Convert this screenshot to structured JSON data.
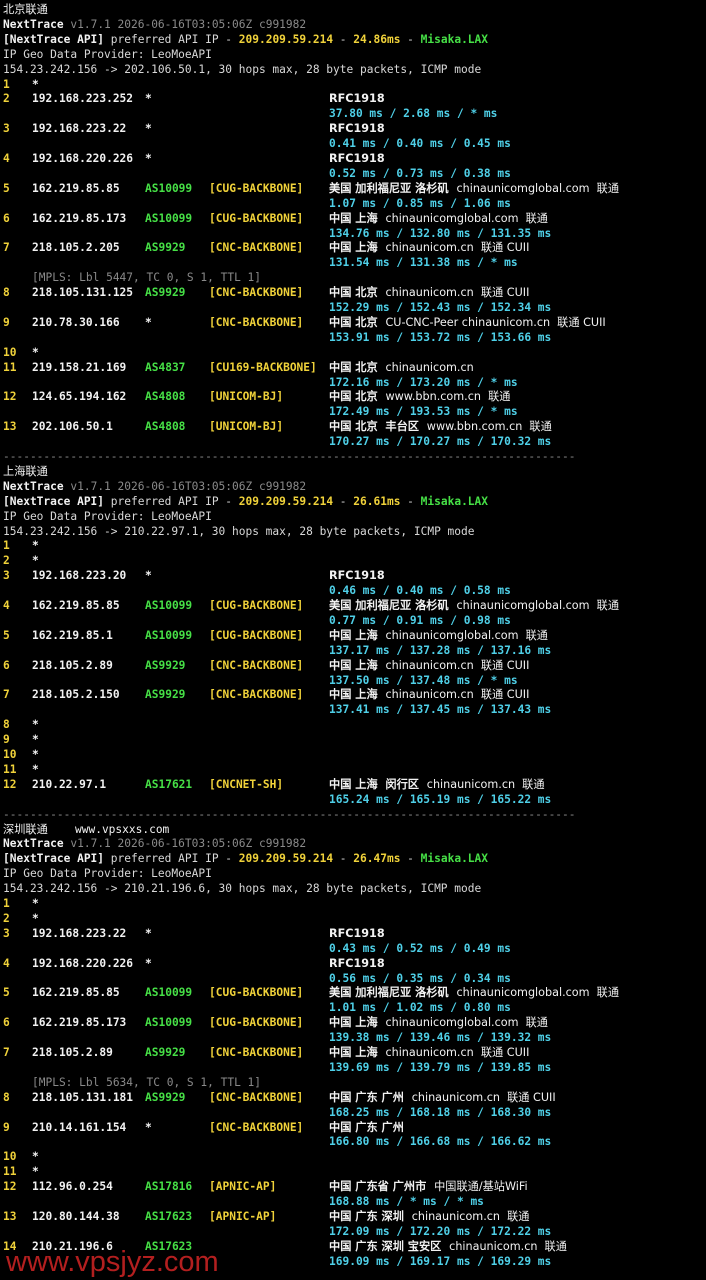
{
  "colors": {
    "background": "#000000",
    "text": "#d8d8d8",
    "hop": "#f0d23a",
    "asn": "#46e046",
    "tag": "#f0d23a",
    "latency": "#4fd0e8",
    "meta": "#8a8a8a",
    "watermark": "#e62828"
  },
  "sections": [
    {
      "heading": "北京联通",
      "heading_extra": "",
      "version": "v1.7.1 2026-06-16T03:05:06Z c991982",
      "api_ip": "209.209.59.214",
      "api_latency": "24.86ms",
      "api_node": "Misaka.LAX",
      "route": "154.23.242.156 -> 202.106.50.1, 30 hops max, 28 byte packets, ICMP mode",
      "hops": [
        {
          "n": "1",
          "ip": "*"
        },
        {
          "n": "2",
          "ip": "192.168.223.252",
          "asn": "*",
          "geo": "RFC1918",
          "rtt": "37.80 ms / 2.68 ms / * ms"
        },
        {
          "n": "3",
          "ip": "192.168.223.22",
          "asn": "*",
          "geo": "RFC1918",
          "rtt": "0.41 ms / 0.40 ms / 0.45 ms"
        },
        {
          "n": "4",
          "ip": "192.168.220.226",
          "asn": "*",
          "geo": "RFC1918",
          "rtt": "0.52 ms / 0.73 ms / 0.38 ms"
        },
        {
          "n": "5",
          "ip": "162.219.85.85",
          "asn": "AS10099",
          "tag": "[CUG-BACKBONE]",
          "geo": "美国 加利福尼亚 洛杉矶",
          "host": "chinaunicomglobal.com  联通",
          "rtt": "1.07 ms / 0.85 ms / 1.06 ms"
        },
        {
          "n": "6",
          "ip": "162.219.85.173",
          "asn": "AS10099",
          "tag": "[CUG-BACKBONE]",
          "geo": "中国 上海",
          "host": "chinaunicomglobal.com  联通",
          "rtt": "134.76 ms / 132.80 ms / 131.35 ms"
        },
        {
          "n": "7",
          "ip": "218.105.2.205",
          "asn": "AS9929",
          "tag": "[CNC-BACKBONE]",
          "geo": "中国 上海",
          "host": "chinaunicom.cn  联通 CUII",
          "rtt": "131.54 ms / 131.38 ms / * ms"
        },
        {
          "n": "8",
          "ip": "218.105.131.125",
          "asn": "AS9929",
          "tag": "[CNC-BACKBONE]",
          "geo": "中国 北京",
          "host": "chinaunicom.cn  联通 CUII",
          "rtt": "152.29 ms / 152.43 ms / 152.34 ms",
          "mpls": "[MPLS: Lbl 5447, TC 0, S 1, TTL 1]"
        },
        {
          "n": "9",
          "ip": "210.78.30.166",
          "asn": "*",
          "tag": "[CNC-BACKBONE]",
          "geo": "中国 北京",
          "host": "CU-CNC-Peer chinaunicom.cn  联通 CUII",
          "rtt": "153.91 ms / 153.72 ms / 153.66 ms"
        },
        {
          "n": "10",
          "ip": "*"
        },
        {
          "n": "11",
          "ip": "219.158.21.169",
          "asn": "AS4837",
          "tag": "[CU169-BACKBONE]",
          "geo": "中国 北京",
          "host": "chinaunicom.cn",
          "rtt": "172.16 ms / 173.20 ms / * ms"
        },
        {
          "n": "12",
          "ip": "124.65.194.162",
          "asn": "AS4808",
          "tag": "[UNICOM-BJ]",
          "geo": "中国 北京",
          "host": "www.bbn.com.cn  联通",
          "rtt": "172.49 ms / 193.53 ms / * ms"
        },
        {
          "n": "13",
          "ip": "202.106.50.1",
          "asn": "AS4808",
          "tag": "[UNICOM-BJ]",
          "geo": "中国 北京  丰台区",
          "host": "www.bbn.com.cn  联通",
          "rtt": "170.27 ms / 170.27 ms / 170.32 ms"
        }
      ]
    },
    {
      "heading": "上海联通",
      "heading_extra": "",
      "version": "v1.7.1 2026-06-16T03:05:06Z c991982",
      "api_ip": "209.209.59.214",
      "api_latency": "26.61ms",
      "api_node": "Misaka.LAX",
      "route": "154.23.242.156 -> 210.22.97.1, 30 hops max, 28 byte packets, ICMP mode",
      "hops": [
        {
          "n": "1",
          "ip": "*"
        },
        {
          "n": "2",
          "ip": "*"
        },
        {
          "n": "3",
          "ip": "192.168.223.20",
          "asn": "*",
          "geo": "RFC1918",
          "rtt": "0.46 ms / 0.40 ms / 0.58 ms"
        },
        {
          "n": "4",
          "ip": "162.219.85.85",
          "asn": "AS10099",
          "tag": "[CUG-BACKBONE]",
          "geo": "美国 加利福尼亚 洛杉矶",
          "host": "chinaunicomglobal.com  联通",
          "rtt": "0.77 ms / 0.91 ms / 0.98 ms"
        },
        {
          "n": "5",
          "ip": "162.219.85.1",
          "asn": "AS10099",
          "tag": "[CUG-BACKBONE]",
          "geo": "中国 上海",
          "host": "chinaunicomglobal.com  联通",
          "rtt": "137.17 ms / 137.28 ms / 137.16 ms"
        },
        {
          "n": "6",
          "ip": "218.105.2.89",
          "asn": "AS9929",
          "tag": "[CNC-BACKBONE]",
          "geo": "中国 上海",
          "host": "chinaunicom.cn  联通 CUII",
          "rtt": "137.50 ms / 137.48 ms / * ms"
        },
        {
          "n": "7",
          "ip": "218.105.2.150",
          "asn": "AS9929",
          "tag": "[CNC-BACKBONE]",
          "geo": "中国 上海",
          "host": "chinaunicom.cn  联通 CUII",
          "rtt": "137.41 ms / 137.45 ms / 137.43 ms"
        },
        {
          "n": "8",
          "ip": "*"
        },
        {
          "n": "9",
          "ip": "*"
        },
        {
          "n": "10",
          "ip": "*"
        },
        {
          "n": "11",
          "ip": "*"
        },
        {
          "n": "12",
          "ip": "210.22.97.1",
          "asn": "AS17621",
          "tag": "[CNCNET-SH]",
          "geo": "中国 上海  闵行区",
          "host": "chinaunicom.cn  联通",
          "rtt": "165.24 ms / 165.19 ms / 165.22 ms"
        }
      ]
    },
    {
      "heading": "深圳联通",
      "heading_extra": "www.vpsxxs.com",
      "version": "v1.7.1 2026-06-16T03:05:06Z c991982",
      "api_ip": "209.209.59.214",
      "api_latency": "26.47ms",
      "api_node": "Misaka.LAX",
      "route": "154.23.242.156 -> 210.21.196.6, 30 hops max, 28 byte packets, ICMP mode",
      "hops": [
        {
          "n": "1",
          "ip": "*"
        },
        {
          "n": "2",
          "ip": "*"
        },
        {
          "n": "3",
          "ip": "192.168.223.22",
          "asn": "*",
          "geo": "RFC1918",
          "rtt": "0.43 ms / 0.52 ms / 0.49 ms"
        },
        {
          "n": "4",
          "ip": "192.168.220.226",
          "asn": "*",
          "geo": "RFC1918",
          "rtt": "0.56 ms / 0.35 ms / 0.34 ms"
        },
        {
          "n": "5",
          "ip": "162.219.85.85",
          "asn": "AS10099",
          "tag": "[CUG-BACKBONE]",
          "geo": "美国 加利福尼亚 洛杉矶",
          "host": "chinaunicomglobal.com  联通",
          "rtt": "1.01 ms / 1.02 ms / 0.80 ms"
        },
        {
          "n": "6",
          "ip": "162.219.85.173",
          "asn": "AS10099",
          "tag": "[CUG-BACKBONE]",
          "geo": "中国 上海",
          "host": "chinaunicomglobal.com  联通",
          "rtt": "139.38 ms / 139.46 ms / 139.32 ms"
        },
        {
          "n": "7",
          "ip": "218.105.2.89",
          "asn": "AS9929",
          "tag": "[CNC-BACKBONE]",
          "geo": "中国 上海",
          "host": "chinaunicom.cn  联通 CUII",
          "rtt": "139.69 ms / 139.79 ms / 139.85 ms"
        },
        {
          "n": "8",
          "ip": "218.105.131.181",
          "asn": "AS9929",
          "tag": "[CNC-BACKBONE]",
          "geo": "中国 广东 广州",
          "host": "chinaunicom.cn  联通 CUII",
          "rtt": "168.25 ms / 168.18 ms / 168.30 ms",
          "mpls": "[MPLS: Lbl 5634, TC 0, S 1, TTL 1]"
        },
        {
          "n": "9",
          "ip": "210.14.161.154",
          "asn": "*",
          "tag": "[CNC-BACKBONE]",
          "geo": "中国 广东 广州",
          "rtt": "166.80 ms / 166.68 ms / 166.62 ms"
        },
        {
          "n": "10",
          "ip": "*"
        },
        {
          "n": "11",
          "ip": "*"
        },
        {
          "n": "12",
          "ip": "112.96.0.254",
          "asn": "AS17816",
          "tag": "[APNIC-AP]",
          "geo": "中国 广东省 广州市",
          "host": "中国联通/基站WiFi",
          "rtt": "168.88 ms / * ms / * ms"
        },
        {
          "n": "13",
          "ip": "120.80.144.38",
          "asn": "AS17623",
          "tag": "[APNIC-AP]",
          "geo": "中国 广东 深圳",
          "host": "chinaunicom.cn  联通",
          "rtt": "172.09 ms / 172.20 ms / 172.22 ms"
        },
        {
          "n": "14",
          "ip": "210.21.196.6",
          "asn": "AS17623",
          "geo": "中国 广东 深圳 宝安区",
          "host": "chinaunicom.cn  联通",
          "rtt": "169.09 ms / 169.17 ms / 169.29 ms"
        }
      ]
    }
  ],
  "labels": {
    "app_name": "NextTrace",
    "api_prefix": "[NextTrace API]",
    "api_text": " preferred API IP - ",
    "api_dash": " - ",
    "geo_provider": "IP Geo Data Provider: LeoMoeAPI",
    "separator": "-------------------------------------------------------------------------------------"
  },
  "watermark": "www.vpsjyz.com"
}
